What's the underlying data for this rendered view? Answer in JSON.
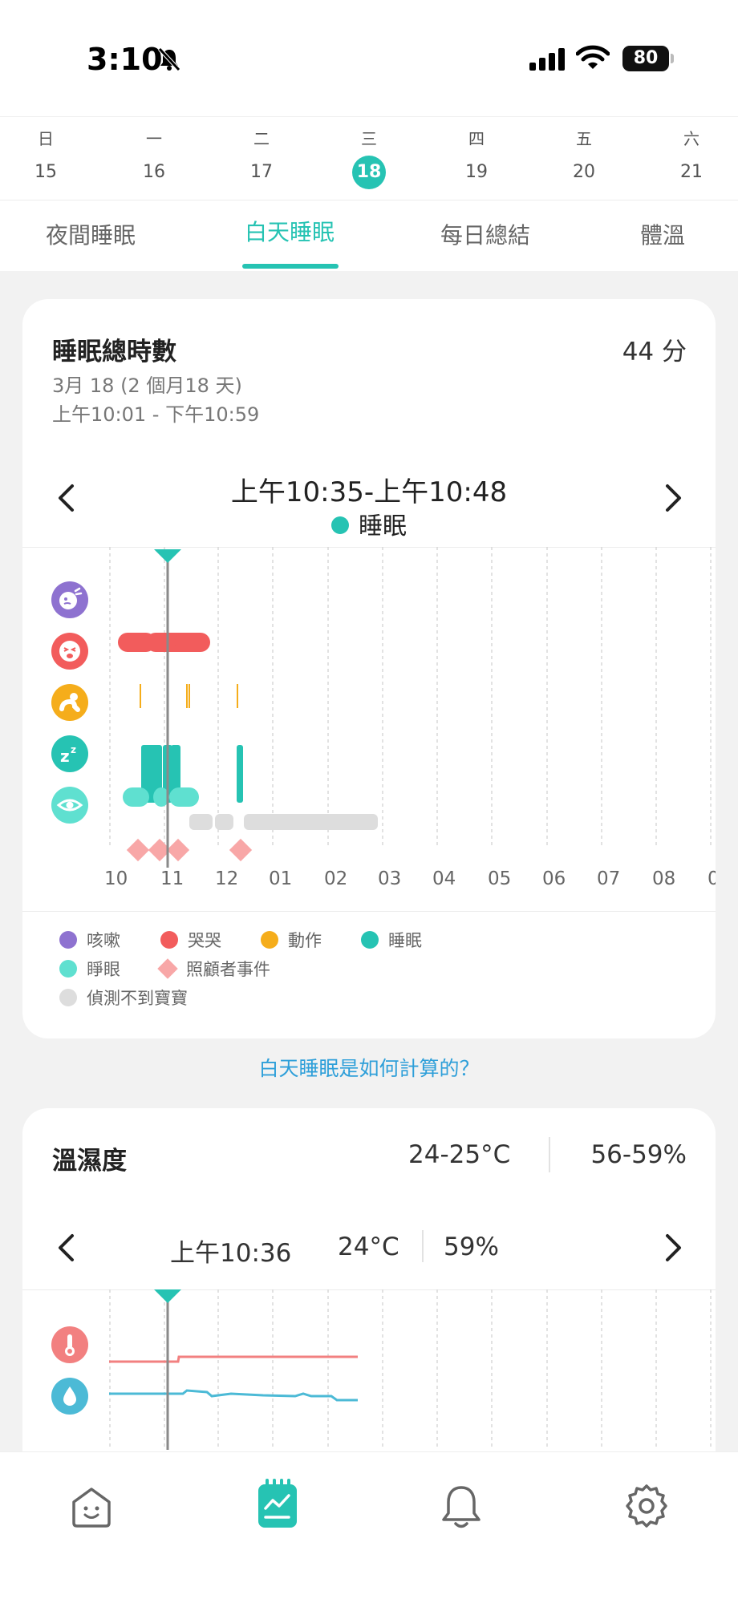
{
  "status_bar": {
    "time": "3:10",
    "battery": "80"
  },
  "week": {
    "days": [
      {
        "weekday": "日",
        "date": "15"
      },
      {
        "weekday": "一",
        "date": "16"
      },
      {
        "weekday": "二",
        "date": "17"
      },
      {
        "weekday": "三",
        "date": "18"
      },
      {
        "weekday": "四",
        "date": "19"
      },
      {
        "weekday": "五",
        "date": "20"
      },
      {
        "weekday": "六",
        "date": "21"
      }
    ],
    "selected_index": 3
  },
  "tabs": [
    "夜間睡眠",
    "白天睡眠",
    "每日總結",
    "體溫"
  ],
  "active_tab": 1,
  "sleep_card": {
    "title": "睡眠總時數",
    "total": "44 分",
    "date_line": "3月 18 (2 個月18 天)",
    "range_line": "上午10:01 - 下午10:59",
    "selected_period": "上午10:35-上午10:48",
    "selected_state": "睡眠",
    "x_labels": [
      "10",
      "11",
      "12",
      "01",
      "02",
      "03",
      "04",
      "05",
      "06",
      "07",
      "08",
      "0"
    ],
    "legend": {
      "cough": "咳嗽",
      "cry": "哭哭",
      "motion": "動作",
      "sleep": "睡眠",
      "awake": "睜眼",
      "caregiver": "照顧者事件",
      "no_baby": "偵測不到寶寶"
    },
    "colors": {
      "cough": "#8e72d0",
      "cry": "#f25c5c",
      "motion": "#f5ad1b",
      "sleep": "#26c3b3",
      "awake": "#5fe0d0",
      "caregiver": "#f8a7a7",
      "no_baby": "#dddddd"
    }
  },
  "help_link": "白天睡眠是如何計算的？",
  "env_card": {
    "title": "溫濕度",
    "temp_range": "24-25°C",
    "humidity_range": "56-59%",
    "sel_time": "上午10:36",
    "sel_temp": "24°C",
    "sel_humidity": "59%",
    "colors": {
      "temp": "#f28080",
      "humidity": "#4cbad6"
    }
  },
  "bottom_nav": {
    "items": [
      "home-icon",
      "report-icon",
      "bell-icon",
      "settings-icon"
    ],
    "active_index": 1
  }
}
